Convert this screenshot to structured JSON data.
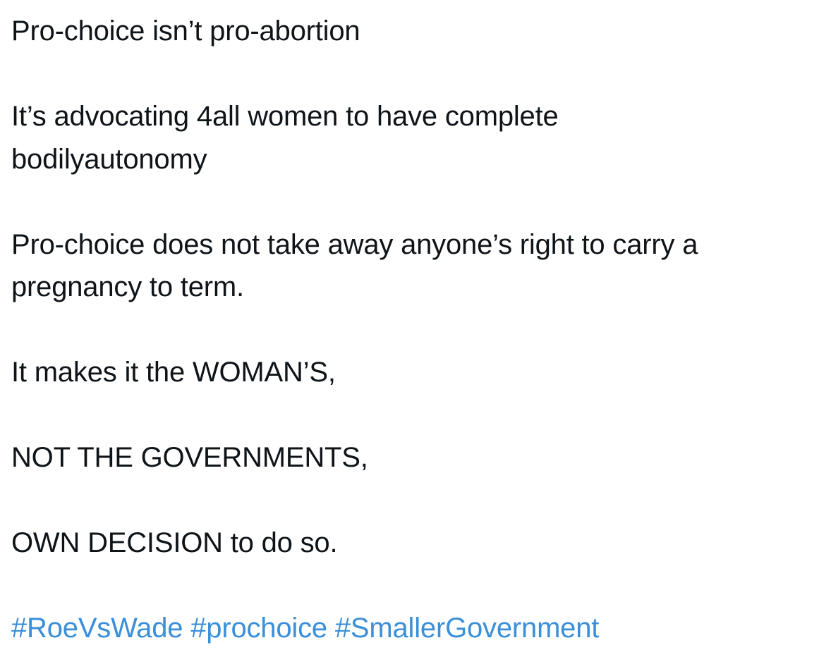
{
  "tweet": {
    "paragraphs": [
      {
        "lines": [
          "Pro-choice isn’t pro-abortion"
        ]
      },
      {
        "lines": [
          "It’s advocating 4all women to have complete",
          "bodilyautonomy"
        ]
      },
      {
        "lines": [
          "Pro-choice does not take away anyone’s right to carry a",
          "pregnancy to term."
        ]
      },
      {
        "lines": [
          "It makes it the WOMAN’S,"
        ]
      },
      {
        "lines": [
          "NOT THE GOVERNMENTS,"
        ]
      },
      {
        "lines": [
          "OWN DECISION to do so."
        ]
      }
    ],
    "hashtags": [
      "#RoeVsWade",
      "#prochoice",
      "#SmallerGovernment"
    ],
    "colors": {
      "text": "#0f1419",
      "hashtag": "#3a8fd9",
      "background": "#ffffff"
    }
  }
}
